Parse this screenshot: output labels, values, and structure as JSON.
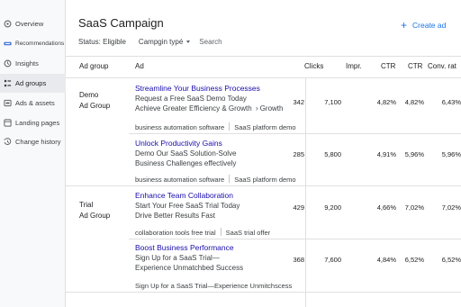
{
  "sidebar": {
    "items": [
      {
        "label": "Overview",
        "icon": "overview-icon"
      },
      {
        "label": "Recommendations",
        "icon": "recommendations-icon"
      },
      {
        "label": "Insights",
        "icon": "insights-icon"
      },
      {
        "label": "Ad groups",
        "icon": "ad-groups-icon",
        "active": true
      },
      {
        "label": "Ads & assets",
        "icon": "ads-assets-icon"
      },
      {
        "label": "Landing pages",
        "icon": "landing-pages-icon"
      },
      {
        "label": "Change history",
        "icon": "change-history-icon"
      }
    ]
  },
  "header": {
    "title": "SaaS Campaign",
    "create_label": "Create ad",
    "status_filter": "Status: Eligible",
    "campaign_type_filter": "Campgin typé",
    "search_placeholder": "Search"
  },
  "table": {
    "headers": {
      "ad_group": "Ad group",
      "ad": "Ad",
      "clicks": "Clicks",
      "impr": "Impr.",
      "ctr": "CTR",
      "ctr2": "CTR",
      "conv_rate": "Conv. rat"
    },
    "groups": [
      {
        "name": "Demo",
        "sub": "Ad Group"
      },
      {
        "name": "Trial",
        "sub": "Ad Group"
      }
    ],
    "rows": [
      {
        "headline": "Streamline Your Business Processes",
        "lines": [
          "Request a Free SaaS Demo Today",
          "Achieve Greater Efficiency & Growth"
        ],
        "extra": "Growth",
        "keywords": [
          "business automation software",
          "SaaS platform demo"
        ],
        "clicks": "342",
        "impr": "7,100",
        "ctr": "4,82%",
        "ctr2": "4,82%",
        "conv": "6,43%"
      },
      {
        "headline": "Unlock Productivity Gains",
        "lines": [
          "Demo Our SaaS Solution-Solve",
          "Business Challenges effectively"
        ],
        "keywords": [
          "business automation software",
          "SaaS platform demo"
        ],
        "clicks": "285",
        "impr": "5,800",
        "ctr": "4,91%",
        "ctr2": "5,96%",
        "conv": "5,96%"
      },
      {
        "headline": "Enhance Team Collaboration",
        "lines": [
          "Start Your Free SaaS Trial Today",
          "Drive Better Results Fast"
        ],
        "keywords": [
          "collaboration tools free trial",
          "SaaS trial offer"
        ],
        "clicks": "429",
        "impr": "9,200",
        "ctr": "4,66%",
        "ctr2": "7,02%",
        "conv": "7,02%"
      },
      {
        "headline": "Boost Business Performance",
        "lines": [
          "Sign Up for a SaaS Trial—",
          "Experience Unmatchbed Success"
        ],
        "keywords": [
          "Sign Up for a SaaS Trial—Experience Unmitchscess"
        ],
        "clicks": "368",
        "impr": "7,600",
        "ctr": "4,84%",
        "ctr2": "6,52%",
        "conv": "6,52%"
      }
    ]
  }
}
